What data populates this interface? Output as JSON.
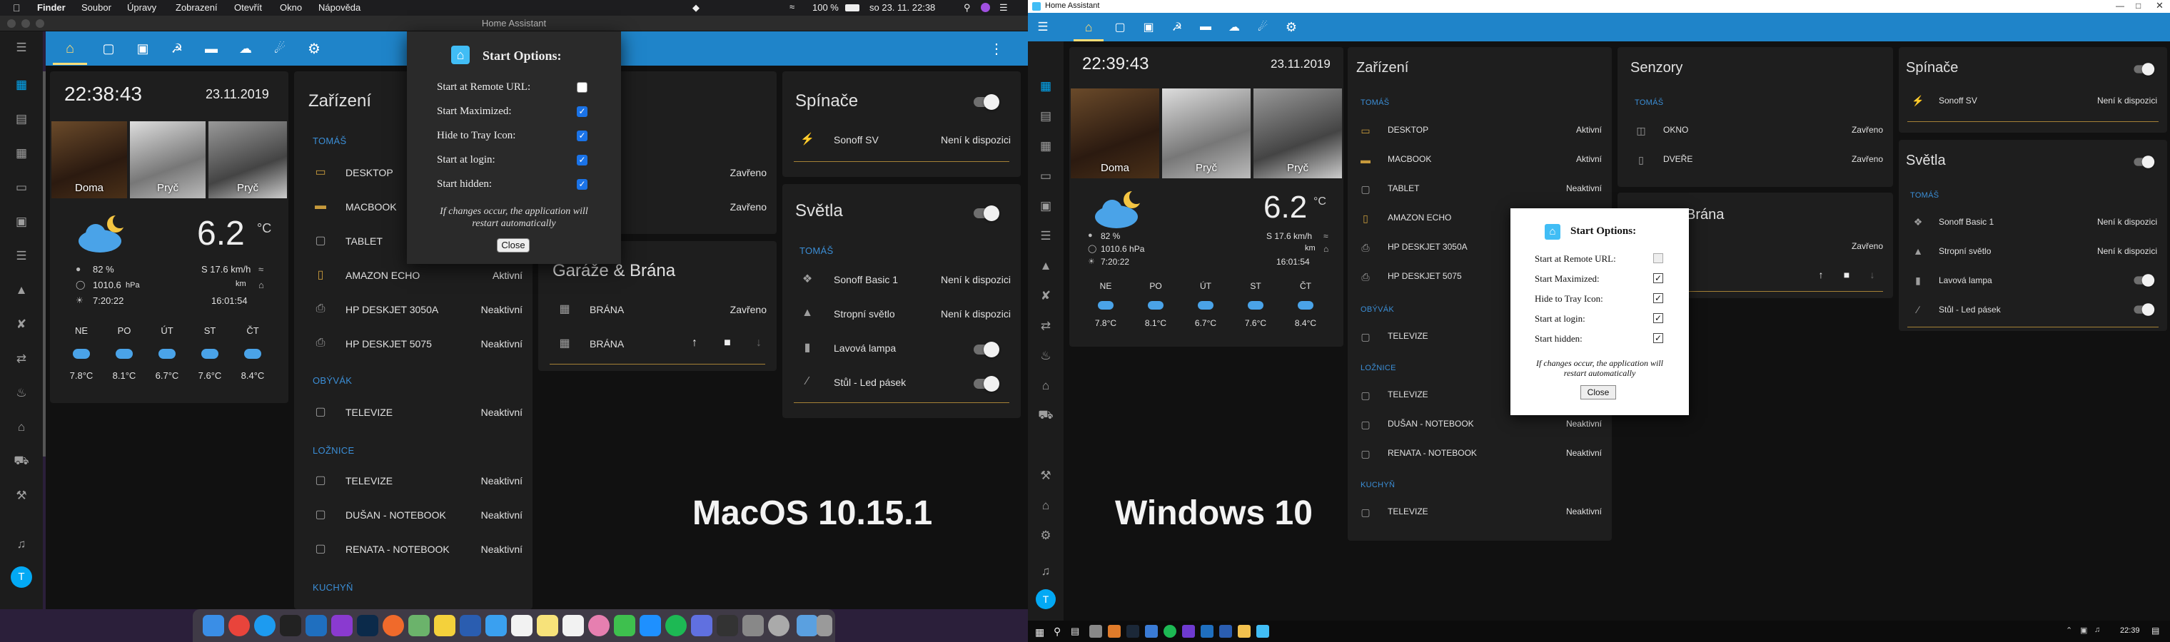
{
  "mac": {
    "menubar": {
      "items": [
        "Finder",
        "Soubor",
        "Úpravy",
        "Zobrazení",
        "Otevřít",
        "Okno",
        "Nápověda"
      ],
      "battery": "100 %",
      "datetime": "so 23. 11.  22:38"
    },
    "window_title": "Home Assistant",
    "clock": {
      "time": "22:38:43",
      "date": "23.11.2019"
    },
    "persons": [
      {
        "name": "Doma"
      },
      {
        "name": "Pryč"
      },
      {
        "name": "Pryč"
      }
    ],
    "weather": {
      "temp": "6.2",
      "unit": "°C",
      "humidity": "82 %",
      "pressure": "1010.6",
      "pressure_unit": "hPa",
      "wind": "S 17.6 km/h",
      "wind_sub": "km",
      "sunrise": "7:20:22",
      "sunset": "16:01:54",
      "forecast": [
        {
          "day": "NE",
          "temp": "7.8°C"
        },
        {
          "day": "PO",
          "temp": "8.1°C"
        },
        {
          "day": "ÚT",
          "temp": "6.7°C"
        },
        {
          "day": "ST",
          "temp": "7.6°C"
        },
        {
          "day": "ČT",
          "temp": "8.4°C"
        }
      ]
    },
    "devices": {
      "title": "Zařízení",
      "sections": [
        {
          "name": "TOMÁŠ",
          "items": [
            {
              "name": "DESKTOP",
              "state": ""
            },
            {
              "name": "MACBOOK",
              "state": ""
            },
            {
              "name": "TABLET",
              "state": ""
            },
            {
              "name": "AMAZON ECHO",
              "state": "Aktivní"
            },
            {
              "name": "HP DESKJET 3050A",
              "state": "Neaktivní"
            },
            {
              "name": "HP DESKJET 5075",
              "state": "Neaktivní"
            }
          ]
        },
        {
          "name": "OBÝVÁK",
          "items": [
            {
              "name": "TELEVIZE",
              "state": "Neaktivní"
            }
          ]
        },
        {
          "name": "LOŽNICE",
          "items": [
            {
              "name": "TELEVIZE",
              "state": "Neaktivní"
            },
            {
              "name": "DUŠAN - NOTEBOOK",
              "state": "Neaktivní"
            },
            {
              "name": "RENATA - NOTEBOOK",
              "state": "Neaktivní"
            }
          ]
        },
        {
          "name": "KUCHYŇ",
          "items": []
        }
      ]
    },
    "sensors": {
      "states": [
        "Zavřeno",
        "Zavřeno"
      ]
    },
    "garage": {
      "title": "Garáže & Brána",
      "items": [
        {
          "name": "BRÁNA",
          "state": "Zavřeno"
        },
        {
          "name": "BRÁNA",
          "state": ""
        }
      ]
    },
    "switches": {
      "title": "Spínače",
      "items": [
        {
          "name": "Sonoff SV",
          "state": "Není k dispozici"
        }
      ]
    },
    "lights": {
      "title": "Světla",
      "section": "TOMÁŠ",
      "items": [
        {
          "name": "Sonoff Basic 1",
          "state": "Není k dispozici"
        },
        {
          "name": "Stropní světlo",
          "state": "Není k dispozici"
        },
        {
          "name": "Lavová lampa",
          "state": ""
        },
        {
          "name": "Stůl - Led pásek",
          "state": ""
        }
      ]
    },
    "dialog": {
      "title": "Start Options:",
      "options": [
        {
          "label": "Start at Remote URL:",
          "checked": false
        },
        {
          "label": "Start Maximized:",
          "checked": true
        },
        {
          "label": "Hide to Tray Icon:",
          "checked": true
        },
        {
          "label": "Start at login:",
          "checked": true
        },
        {
          "label": "Start hidden:",
          "checked": true
        }
      ],
      "note": "If changes occur, the application will restart automatically",
      "close": "Close"
    },
    "avatar": "T",
    "overlay": "MacOS 10.15.1"
  },
  "win": {
    "window_title": "Home Assistant",
    "clock": {
      "time": "22:39:43",
      "date": "23.11.2019"
    },
    "persons": [
      {
        "name": "Doma"
      },
      {
        "name": "Pryč"
      },
      {
        "name": "Pryč"
      }
    ],
    "weather": {
      "temp": "6.2",
      "unit": "°C",
      "humidity": "82 %",
      "pressure": "1010.6 hPa",
      "wind": "S 17.6 km/h",
      "wind_sub": "km",
      "sunrise": "7:20:22",
      "sunset": "16:01:54",
      "forecast": [
        {
          "day": "NE",
          "temp": "7.8°C"
        },
        {
          "day": "PO",
          "temp": "8.1°C"
        },
        {
          "day": "ÚT",
          "temp": "6.7°C"
        },
        {
          "day": "ST",
          "temp": "7.6°C"
        },
        {
          "day": "ČT",
          "temp": "8.4°C"
        }
      ]
    },
    "devices": {
      "title": "Zařízení",
      "sections": [
        {
          "name": "TOMÁŠ",
          "items": [
            {
              "name": "DESKTOP",
              "state": "Aktivní"
            },
            {
              "name": "MACBOOK",
              "state": "Aktivní"
            },
            {
              "name": "TABLET",
              "state": "Neaktivní"
            },
            {
              "name": "AMAZON ECHO",
              "state": ""
            },
            {
              "name": "HP DESKJET 3050A",
              "state": ""
            },
            {
              "name": "HP DESKJET 5075",
              "state": ""
            }
          ]
        },
        {
          "name": "OBÝVÁK",
          "items": [
            {
              "name": "TELEVIZE",
              "state": ""
            }
          ]
        },
        {
          "name": "LOŽNICE",
          "items": [
            {
              "name": "TELEVIZE",
              "state": ""
            },
            {
              "name": "DUŠAN - NOTEBOOK",
              "state": "Neaktivní"
            },
            {
              "name": "RENATA - NOTEBOOK",
              "state": "Neaktivní"
            }
          ]
        },
        {
          "name": "KUCHYŇ",
          "items": [
            {
              "name": "TELEVIZE",
              "state": "Neaktivní"
            }
          ]
        }
      ]
    },
    "sensors": {
      "title": "Senzory",
      "section": "TOMÁŠ",
      "items": [
        {
          "name": "OKNO",
          "state": "Zavřeno"
        },
        {
          "name": "DVEŘE",
          "state": "Zavřeno"
        }
      ]
    },
    "garage": {
      "title": "Brána",
      "state": "Zavřeno"
    },
    "switches": {
      "title": "Spínače",
      "items": [
        {
          "name": "Sonoff SV",
          "state": "Není k dispozici"
        }
      ]
    },
    "lights": {
      "title": "Světla",
      "section": "TOMÁŠ",
      "items": [
        {
          "name": "Sonoff Basic 1",
          "state": "Není k dispozici"
        },
        {
          "name": "Stropní světlo",
          "state": "Není k dispozici"
        },
        {
          "name": "Lavová lampa",
          "state": ""
        },
        {
          "name": "Stůl - Led pásek",
          "state": ""
        }
      ]
    },
    "dialog": {
      "title": "Start Options:",
      "options": [
        {
          "label": "Start at Remote URL:",
          "checked": false
        },
        {
          "label": "Start Maximized:",
          "checked": true
        },
        {
          "label": "Hide to Tray Icon:",
          "checked": true
        },
        {
          "label": "Start at login:",
          "checked": true
        },
        {
          "label": "Start hidden:",
          "checked": true
        }
      ],
      "note": "If changes occur, the application will restart automatically",
      "close": "Close"
    },
    "avatar": "T",
    "taskbar_time": "22:39",
    "overlay": "Windows 10"
  },
  "colors": {
    "ha_blue": "#03a9f4",
    "header_blue": "#1f84c9",
    "accent_orange": "#c79a3c",
    "section_blue": "#3b8ed6",
    "card": "#1e1e1e",
    "page": "#111111"
  }
}
